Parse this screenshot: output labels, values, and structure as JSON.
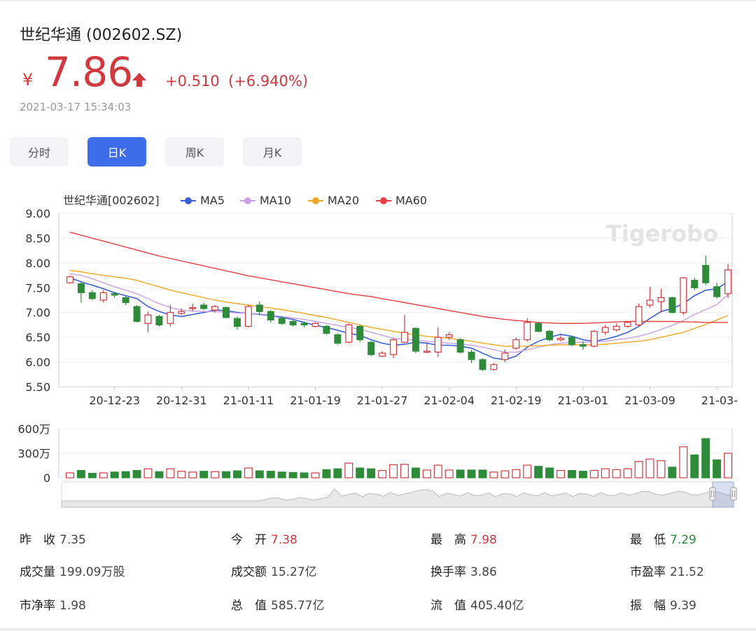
{
  "header": {
    "title": "世纪华通 (002602.SZ)",
    "currency": "¥",
    "price": "7.86",
    "change": "+0.510",
    "change_pct": "(+6.940%)",
    "timestamp": "2021-03-17 15:34:03",
    "colors": {
      "up": "#d0393e",
      "down": "#2e8b3a",
      "accent": "#3d6de8"
    }
  },
  "tabs": [
    {
      "label": "分时",
      "active": false
    },
    {
      "label": "日K",
      "active": true
    },
    {
      "label": "周K",
      "active": false
    },
    {
      "label": "月K",
      "active": false
    }
  ],
  "chart_data": {
    "type": "candlestick",
    "legend": [
      {
        "name": "世纪华通[002602]",
        "color": ""
      },
      {
        "name": "MA5",
        "color": "#3a5fd9"
      },
      {
        "name": "MA10",
        "color": "#c8a0e8"
      },
      {
        "name": "MA20",
        "color": "#f5a623"
      },
      {
        "name": "MA60",
        "color": "#e84040"
      }
    ],
    "watermark": "Tigerobo",
    "y_ticks": [
      "9.00",
      "8.50",
      "8.00",
      "7.50",
      "7.00",
      "6.50",
      "6.00",
      "5.50"
    ],
    "ylim": [
      5.5,
      9.0
    ],
    "x_ticks": [
      "20-12-23",
      "20-12-31",
      "21-01-11",
      "21-01-19",
      "21-01-27",
      "21-02-04",
      "21-02-19",
      "21-03-01",
      "21-03-09",
      "21-03-"
    ],
    "volume_ticks": [
      "600万",
      "300万",
      "0"
    ],
    "volume_max": 600,
    "candles": [
      {
        "o": 7.6,
        "c": 7.72,
        "h": 7.75,
        "l": 7.58
      },
      {
        "o": 7.58,
        "c": 7.4,
        "h": 7.62,
        "l": 7.2
      },
      {
        "o": 7.4,
        "c": 7.28,
        "h": 7.45,
        "l": 7.25
      },
      {
        "o": 7.25,
        "c": 7.4,
        "h": 7.45,
        "l": 7.2
      },
      {
        "o": 7.38,
        "c": 7.35,
        "h": 7.42,
        "l": 7.3
      },
      {
        "o": 7.3,
        "c": 7.2,
        "h": 7.35,
        "l": 7.15
      },
      {
        "o": 7.12,
        "c": 6.82,
        "h": 7.15,
        "l": 6.8
      },
      {
        "o": 6.78,
        "c": 6.95,
        "h": 7.02,
        "l": 6.6
      },
      {
        "o": 6.92,
        "c": 6.75,
        "h": 6.95,
        "l": 6.72
      },
      {
        "o": 6.78,
        "c": 7.0,
        "h": 7.15,
        "l": 6.72
      },
      {
        "o": 6.98,
        "c": 7.02,
        "h": 7.08,
        "l": 6.95
      },
      {
        "o": 7.08,
        "c": 7.1,
        "h": 7.18,
        "l": 7.02
      },
      {
        "o": 7.15,
        "c": 7.08,
        "h": 7.2,
        "l": 7.05
      },
      {
        "o": 7.05,
        "c": 7.12,
        "h": 7.15,
        "l": 7.0
      },
      {
        "o": 7.1,
        "c": 6.9,
        "h": 7.12,
        "l": 6.88
      },
      {
        "o": 6.88,
        "c": 6.72,
        "h": 6.92,
        "l": 6.65
      },
      {
        "o": 6.72,
        "c": 7.12,
        "h": 7.15,
        "l": 6.7
      },
      {
        "o": 7.15,
        "c": 7.02,
        "h": 7.22,
        "l": 6.95
      },
      {
        "o": 7.02,
        "c": 6.85,
        "h": 7.05,
        "l": 6.8
      },
      {
        "o": 6.88,
        "c": 6.78,
        "h": 6.92,
        "l": 6.75
      },
      {
        "o": 6.82,
        "c": 6.75,
        "h": 6.85,
        "l": 6.72
      },
      {
        "o": 6.78,
        "c": 6.75,
        "h": 6.82,
        "l": 6.7
      },
      {
        "o": 6.72,
        "c": 6.78,
        "h": 6.8,
        "l": 6.7
      },
      {
        "o": 6.72,
        "c": 6.58,
        "h": 6.75,
        "l": 6.55
      },
      {
        "o": 6.55,
        "c": 6.38,
        "h": 6.58,
        "l": 6.35
      },
      {
        "o": 6.4,
        "c": 6.75,
        "h": 6.78,
        "l": 6.38
      },
      {
        "o": 6.72,
        "c": 6.45,
        "h": 6.75,
        "l": 6.4
      },
      {
        "o": 6.4,
        "c": 6.15,
        "h": 6.42,
        "l": 6.12
      },
      {
        "o": 6.12,
        "c": 6.18,
        "h": 6.22,
        "l": 6.1
      },
      {
        "o": 6.15,
        "c": 6.45,
        "h": 6.48,
        "l": 6.08
      },
      {
        "o": 6.4,
        "c": 6.6,
        "h": 6.95,
        "l": 6.38
      },
      {
        "o": 6.68,
        "c": 6.22,
        "h": 6.7,
        "l": 6.18
      },
      {
        "o": 6.2,
        "c": 6.22,
        "h": 6.4,
        "l": 6.18
      },
      {
        "o": 6.2,
        "c": 6.5,
        "h": 6.7,
        "l": 6.1
      },
      {
        "o": 6.5,
        "c": 6.55,
        "h": 6.6,
        "l": 6.45
      },
      {
        "o": 6.45,
        "c": 6.2,
        "h": 6.48,
        "l": 6.18
      },
      {
        "o": 6.2,
        "c": 6.05,
        "h": 6.25,
        "l": 5.98
      },
      {
        "o": 6.05,
        "c": 5.85,
        "h": 6.08,
        "l": 5.82
      },
      {
        "o": 5.85,
        "c": 5.95,
        "h": 5.98,
        "l": 5.83
      },
      {
        "o": 6.05,
        "c": 6.18,
        "h": 6.25,
        "l": 6.0
      },
      {
        "o": 6.28,
        "c": 6.45,
        "h": 6.5,
        "l": 6.25
      },
      {
        "o": 6.45,
        "c": 6.8,
        "h": 6.88,
        "l": 6.42
      },
      {
        "o": 6.78,
        "c": 6.62,
        "h": 6.8,
        "l": 6.6
      },
      {
        "o": 6.62,
        "c": 6.45,
        "h": 6.65,
        "l": 6.42
      },
      {
        "o": 6.45,
        "c": 6.48,
        "h": 6.55,
        "l": 6.42
      },
      {
        "o": 6.5,
        "c": 6.35,
        "h": 6.52,
        "l": 6.32
      },
      {
        "o": 6.35,
        "c": 6.32,
        "h": 6.42,
        "l": 6.25
      },
      {
        "o": 6.32,
        "c": 6.62,
        "h": 6.65,
        "l": 6.3
      },
      {
        "o": 6.6,
        "c": 6.7,
        "h": 6.75,
        "l": 6.55
      },
      {
        "o": 6.65,
        "c": 6.72,
        "h": 6.78,
        "l": 6.62
      },
      {
        "o": 6.72,
        "c": 6.8,
        "h": 6.82,
        "l": 6.7
      },
      {
        "o": 6.75,
        "c": 7.12,
        "h": 7.18,
        "l": 6.72
      },
      {
        "o": 7.15,
        "c": 7.25,
        "h": 7.52,
        "l": 7.1
      },
      {
        "o": 7.22,
        "c": 7.3,
        "h": 7.48,
        "l": 7.0
      },
      {
        "o": 7.3,
        "c": 7.0,
        "h": 7.32,
        "l": 6.98
      },
      {
        "o": 7.0,
        "c": 7.7,
        "h": 7.72,
        "l": 6.95
      },
      {
        "o": 7.65,
        "c": 7.5,
        "h": 7.7,
        "l": 7.45
      },
      {
        "o": 7.95,
        "c": 7.6,
        "h": 8.15,
        "l": 7.55
      },
      {
        "o": 7.52,
        "c": 7.32,
        "h": 7.6,
        "l": 7.28
      },
      {
        "o": 7.38,
        "c": 7.86,
        "h": 7.98,
        "l": 7.29
      }
    ],
    "volumes": [
      60,
      90,
      55,
      60,
      70,
      75,
      90,
      110,
      75,
      110,
      80,
      70,
      80,
      75,
      75,
      85,
      120,
      85,
      80,
      70,
      65,
      60,
      60,
      100,
      110,
      180,
      120,
      110,
      90,
      160,
      165,
      120,
      95,
      155,
      95,
      95,
      95,
      95,
      70,
      85,
      100,
      155,
      140,
      120,
      90,
      90,
      80,
      90,
      110,
      100,
      110,
      200,
      230,
      210,
      130,
      380,
      280,
      480,
      220,
      300
    ],
    "ma": {
      "MA5": [
        7.7,
        7.62,
        7.55,
        7.48,
        7.4,
        7.34,
        7.28,
        7.12,
        7.02,
        6.95,
        6.92,
        6.96,
        7.0,
        7.05,
        7.04,
        7.0,
        6.98,
        6.96,
        6.94,
        6.9,
        6.86,
        6.8,
        6.74,
        6.7,
        6.64,
        6.58,
        6.54,
        6.45,
        6.38,
        6.34,
        6.36,
        6.4,
        6.38,
        6.34,
        6.34,
        6.32,
        6.28,
        6.18,
        6.08,
        6.05,
        6.12,
        6.3,
        6.42,
        6.5,
        6.56,
        6.52,
        6.45,
        6.42,
        6.46,
        6.52,
        6.6,
        6.72,
        6.88,
        7.02,
        7.08,
        7.18,
        7.34,
        7.45,
        7.48,
        7.62
      ],
      "MA10": [
        7.78,
        7.75,
        7.68,
        7.6,
        7.52,
        7.45,
        7.38,
        7.28,
        7.18,
        7.1,
        7.05,
        7.03,
        7.02,
        7.02,
        7.01,
        6.99,
        6.98,
        6.97,
        6.95,
        6.92,
        6.89,
        6.86,
        6.82,
        6.78,
        6.74,
        6.7,
        6.66,
        6.6,
        6.54,
        6.48,
        6.46,
        6.44,
        6.42,
        6.4,
        6.38,
        6.36,
        6.34,
        6.3,
        6.25,
        6.2,
        6.2,
        6.25,
        6.3,
        6.35,
        6.38,
        6.4,
        6.4,
        6.4,
        6.42,
        6.45,
        6.48,
        6.52,
        6.58,
        6.66,
        6.74,
        6.84,
        6.96,
        7.06,
        7.16,
        7.36
      ],
      "MA20": [
        7.85,
        7.82,
        7.78,
        7.75,
        7.72,
        7.69,
        7.65,
        7.58,
        7.52,
        7.45,
        7.4,
        7.35,
        7.3,
        7.25,
        7.21,
        7.18,
        7.15,
        7.12,
        7.09,
        7.06,
        7.02,
        6.98,
        6.94,
        6.9,
        6.85,
        6.8,
        6.75,
        6.7,
        6.66,
        6.62,
        6.58,
        6.55,
        6.52,
        6.5,
        6.48,
        6.45,
        6.42,
        6.38,
        6.35,
        6.32,
        6.32,
        6.32,
        6.33,
        6.34,
        6.35,
        6.35,
        6.35,
        6.35,
        6.36,
        6.38,
        6.4,
        6.42,
        6.45,
        6.5,
        6.55,
        6.6,
        6.68,
        6.76,
        6.85,
        6.94
      ],
      "MA60": [
        8.62,
        8.56,
        8.5,
        8.44,
        8.38,
        8.32,
        8.26,
        8.2,
        8.14,
        8.09,
        8.04,
        7.99,
        7.94,
        7.89,
        7.84,
        7.79,
        7.74,
        7.7,
        7.66,
        7.62,
        7.58,
        7.54,
        7.5,
        7.46,
        7.42,
        7.38,
        7.35,
        7.32,
        7.28,
        7.24,
        7.2,
        7.16,
        7.12,
        7.08,
        7.04,
        7.0,
        6.96,
        6.92,
        6.89,
        6.86,
        6.84,
        6.82,
        6.8,
        6.79,
        6.78,
        6.78,
        6.78,
        6.79,
        6.8,
        6.81,
        6.82,
        6.82,
        6.82,
        6.82,
        6.82,
        6.81,
        6.81,
        6.8,
        6.8,
        6.8
      ]
    }
  },
  "stats": [
    {
      "label": "昨　收",
      "value": "7.35",
      "tone": ""
    },
    {
      "label": "今　开",
      "value": "7.38",
      "tone": "up"
    },
    {
      "label": "最　高",
      "value": "7.98",
      "tone": "up"
    },
    {
      "label": "最　低",
      "value": "7.29",
      "tone": "down"
    },
    {
      "label": "成交量",
      "value": "199.09万股",
      "tone": ""
    },
    {
      "label": "成交额",
      "value": "15.27亿",
      "tone": ""
    },
    {
      "label": "换手率",
      "value": "3.86",
      "tone": ""
    },
    {
      "label": "市盈率",
      "value": "21.52",
      "tone": ""
    },
    {
      "label": "市净率",
      "value": "1.98",
      "tone": ""
    },
    {
      "label": "总　值",
      "value": "585.77亿",
      "tone": ""
    },
    {
      "label": "流　值",
      "value": "405.40亿",
      "tone": ""
    },
    {
      "label": "振　幅",
      "value": "9.39",
      "tone": ""
    }
  ]
}
